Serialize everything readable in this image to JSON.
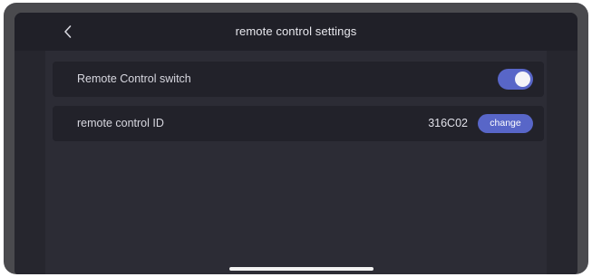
{
  "header": {
    "back_icon": "chevron-left-icon",
    "title": "remote control settings"
  },
  "settings": {
    "remote_switch": {
      "label": "Remote Control switch",
      "enabled": true
    },
    "remote_id": {
      "label": "remote control ID",
      "value": "316C02",
      "button_label": "change"
    }
  },
  "colors": {
    "accent": "#5866c8",
    "background": "#2c2c35",
    "row_background": "#22222a",
    "header_background": "#202028"
  }
}
